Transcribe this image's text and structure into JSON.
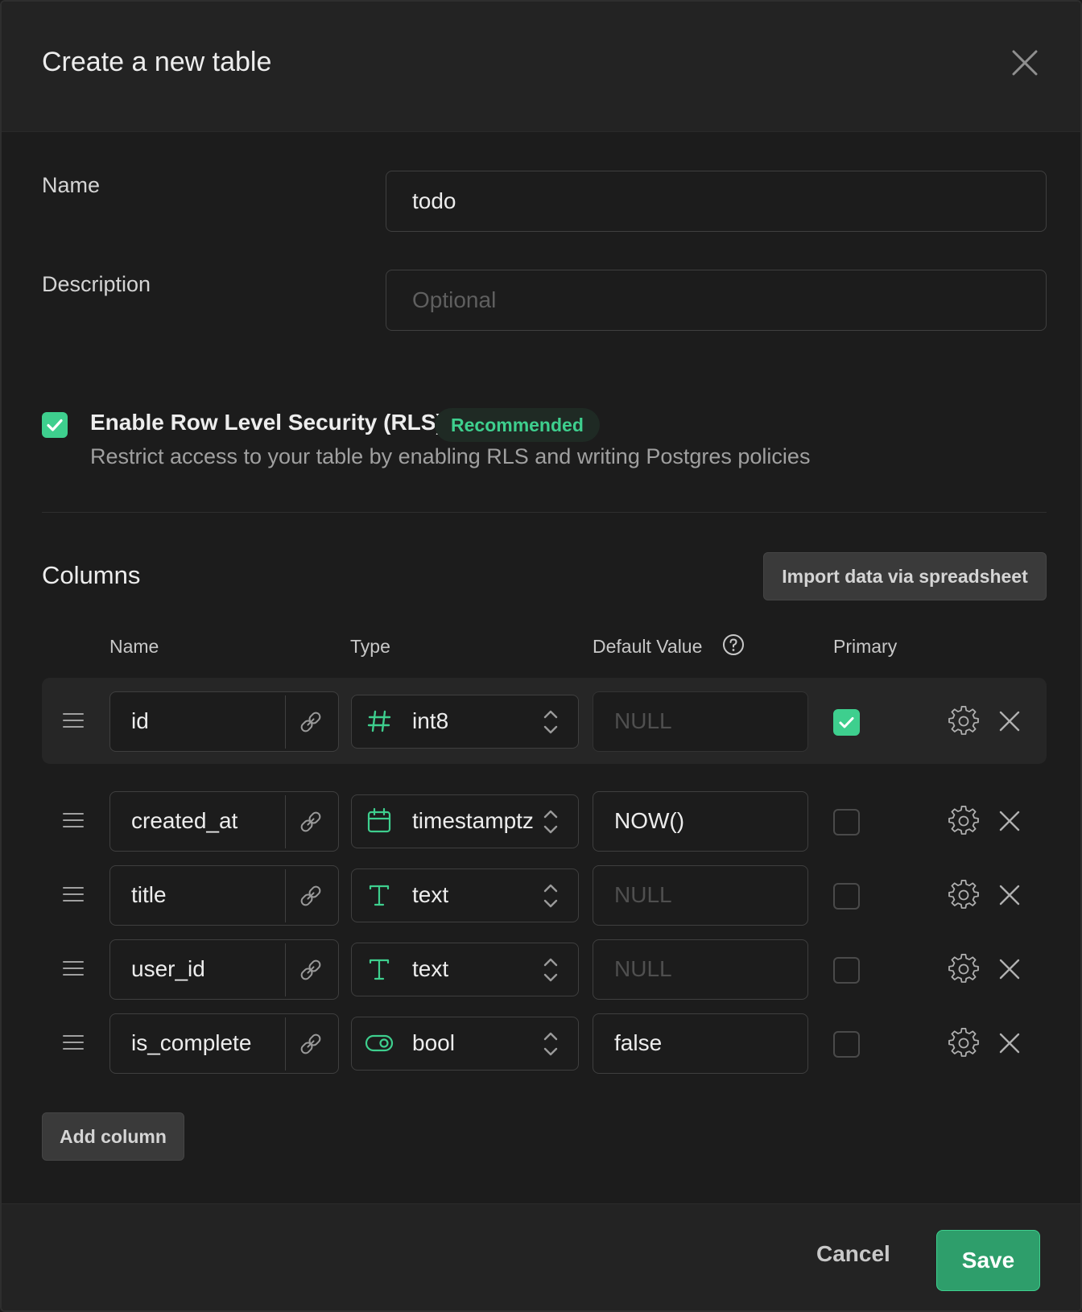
{
  "header": {
    "title": "Create a new table",
    "close_icon": "close-icon"
  },
  "form": {
    "name_label": "Name",
    "name_value": "todo",
    "description_label": "Description",
    "description_placeholder": "Optional"
  },
  "rls": {
    "checked": true,
    "title": "Enable Row Level Security (RLS)",
    "badge": "Recommended",
    "description": "Restrict access to your table by enabling RLS and writing Postgres policies"
  },
  "columns": {
    "title": "Columns",
    "import_label": "Import data via spreadsheet",
    "headers": {
      "name": "Name",
      "type": "Type",
      "default": "Default Value",
      "primary": "Primary"
    },
    "rows": [
      {
        "name": "id",
        "type": "int8",
        "type_icon": "hash-icon",
        "default": "NULL",
        "default_is_placeholder": true,
        "primary": true
      },
      {
        "name": "created_at",
        "type": "timestamptz",
        "type_icon": "calendar-icon",
        "default": "NOW()",
        "default_is_placeholder": false,
        "primary": false
      },
      {
        "name": "title",
        "type": "text",
        "type_icon": "text-icon",
        "default": "NULL",
        "default_is_placeholder": true,
        "primary": false
      },
      {
        "name": "user_id",
        "type": "text",
        "type_icon": "text-icon",
        "default": "NULL",
        "default_is_placeholder": true,
        "primary": false
      },
      {
        "name": "is_complete",
        "type": "bool",
        "type_icon": "toggle-icon",
        "default": "false",
        "default_is_placeholder": false,
        "primary": false
      }
    ],
    "add_label": "Add column"
  },
  "footer": {
    "cancel_label": "Cancel",
    "save_label": "Save"
  },
  "colors": {
    "accent": "#3ecf8e",
    "background": "#1c1c1c",
    "surface": "#232323"
  }
}
